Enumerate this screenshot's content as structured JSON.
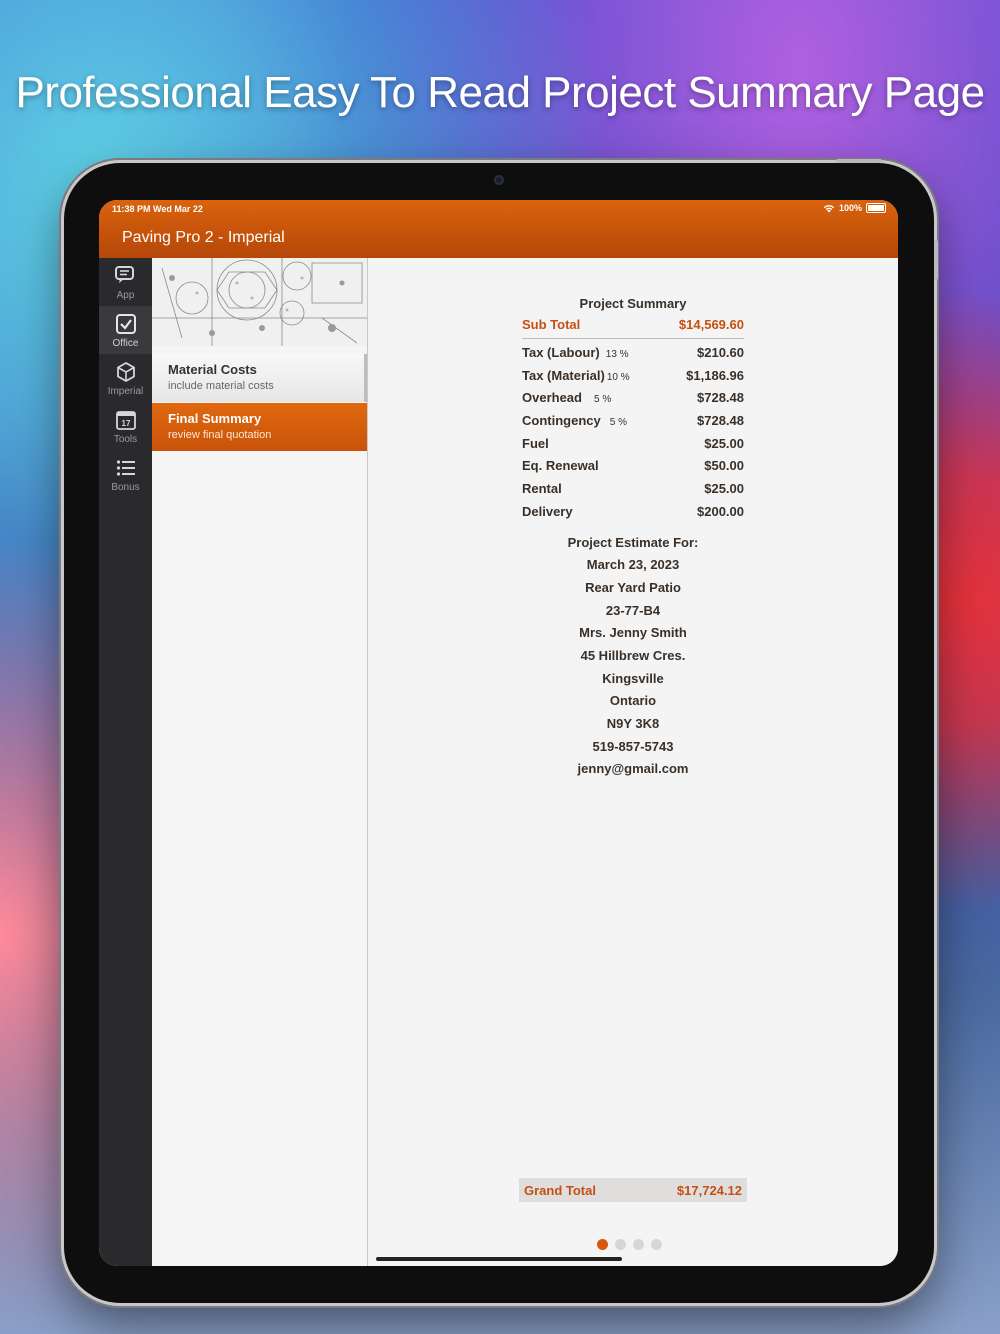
{
  "headline": "Professional Easy To Read Project Summary Page",
  "status": {
    "time": "11:38 PM  Wed Mar 22",
    "battery": "100%"
  },
  "app": {
    "title": "Paving Pro 2 - Imperial"
  },
  "tabs": [
    {
      "label": "App",
      "icon": "chat-bubbles-icon"
    },
    {
      "label": "Office",
      "icon": "checkbox-icon"
    },
    {
      "label": "Imperial",
      "icon": "cube-icon"
    },
    {
      "label": "Tools",
      "icon": "calendar-icon",
      "day": "17"
    },
    {
      "label": "Bonus",
      "icon": "list-icon"
    }
  ],
  "menu": [
    {
      "title": "Material Costs",
      "subtitle": "include material costs"
    },
    {
      "title": "Final Summary",
      "subtitle": "review final quotation"
    }
  ],
  "summary": {
    "title": "Project Summary",
    "subtotal_label": "Sub Total",
    "subtotal_value": "$14,569.60",
    "rows": [
      {
        "label": "Tax (Labour)",
        "pct": "13 %",
        "value": "$210.60"
      },
      {
        "label": "Tax (Material)",
        "pct": "10 %",
        "value": "$1,186.96"
      },
      {
        "label": "Overhead",
        "pct": "5 %",
        "value": "$728.48"
      },
      {
        "label": "Contingency",
        "pct": "5 %",
        "value": "$728.48"
      },
      {
        "label": "Fuel",
        "pct": "",
        "value": "$25.00"
      },
      {
        "label": "Eq. Renewal",
        "pct": "",
        "value": "$50.00"
      },
      {
        "label": "Rental",
        "pct": "",
        "value": "$25.00"
      },
      {
        "label": "Delivery",
        "pct": "",
        "value": "$200.00"
      }
    ],
    "estimate": [
      "Project Estimate For:",
      "March 23, 2023",
      "Rear Yard Patio",
      "23-77-B4",
      "Mrs. Jenny Smith",
      "45 Hillbrew Cres.",
      "Kingsville",
      "Ontario",
      "N9Y 3K8",
      "519-857-5743",
      "jenny@gmail.com"
    ],
    "grand_total_label": "Grand Total",
    "grand_total_value": "$17,724.12"
  },
  "pager": {
    "pages": 4,
    "current": 1
  },
  "colors": {
    "accent": "#c9530a",
    "text": "#3a3028"
  }
}
